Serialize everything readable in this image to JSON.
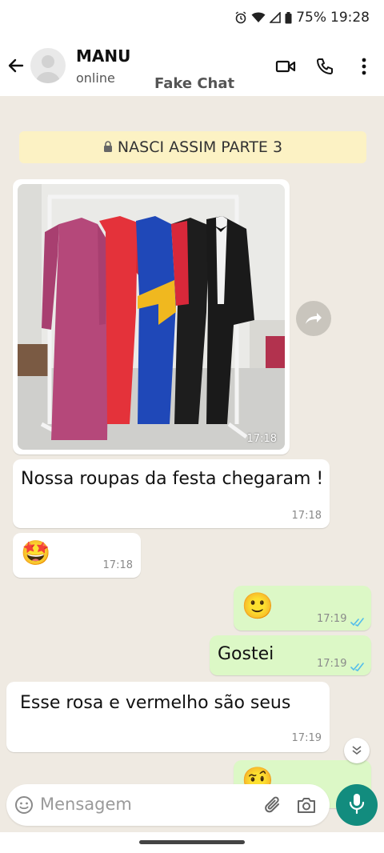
{
  "status_bar": {
    "battery": "75%",
    "time": "19:28"
  },
  "header": {
    "contact_name": "MANU",
    "contact_status": "online",
    "watermark": "Fake Chat"
  },
  "chat": {
    "banner": "NASCI ASSIM PARTE 3",
    "messages": [
      {
        "type": "image",
        "direction": "in",
        "time": "17:18"
      },
      {
        "type": "text",
        "direction": "in",
        "text": "Nossa roupas da festa chegaram !",
        "time": "17:18"
      },
      {
        "type": "emoji",
        "direction": "in",
        "text": "🤩",
        "time": "17:18"
      },
      {
        "type": "emoji",
        "direction": "out",
        "text": "🙂",
        "time": "17:19",
        "read": true
      },
      {
        "type": "text",
        "direction": "out",
        "text": "Gostei",
        "time": "17:19",
        "read": true
      },
      {
        "type": "text",
        "direction": "in",
        "text": "Esse rosa e vermelho são seus",
        "time": "17:19"
      },
      {
        "type": "emoji",
        "direction": "out",
        "text": "🤨",
        "time": "",
        "partial": true
      }
    ]
  },
  "input": {
    "placeholder": "Mensagem"
  },
  "colors": {
    "incoming": "#ffffff",
    "outgoing": "#dcf8c6",
    "chat_bg": "#efeae2",
    "accent": "#128c7e",
    "read_ticks": "#53bdeb"
  }
}
